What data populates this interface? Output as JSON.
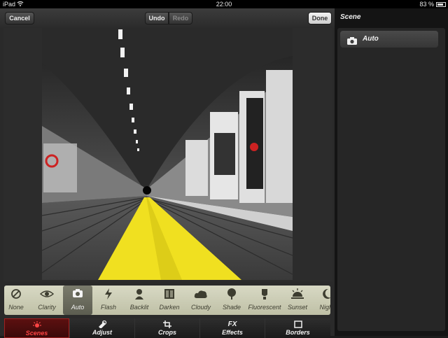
{
  "status_bar": {
    "device": "iPad",
    "time": "22:00",
    "battery": "83 %",
    "battery_level": 0.83
  },
  "toolbar": {
    "cancel_label": "Cancel",
    "undo_label": "Undo",
    "redo_label": "Redo",
    "done_label": "Done"
  },
  "scenes": [
    {
      "label": "None",
      "icon": "none-icon",
      "selected": false
    },
    {
      "label": "Clarity",
      "icon": "eye-icon",
      "selected": false
    },
    {
      "label": "Auto",
      "icon": "camera-icon",
      "selected": true
    },
    {
      "label": "Flash",
      "icon": "flash-icon",
      "selected": false
    },
    {
      "label": "Backlit",
      "icon": "backlit-icon",
      "selected": false
    },
    {
      "label": "Darken",
      "icon": "darken-icon",
      "selected": false
    },
    {
      "label": "Cloudy",
      "icon": "cloud-icon",
      "selected": false
    },
    {
      "label": "Shade",
      "icon": "tree-icon",
      "selected": false
    },
    {
      "label": "Fluorescent",
      "icon": "fluorescent-icon",
      "selected": false
    },
    {
      "label": "Sunset",
      "icon": "sunset-icon",
      "selected": false
    },
    {
      "label": "Night",
      "icon": "moon-icon",
      "selected": false
    }
  ],
  "tabs": [
    {
      "label": "Scenes",
      "icon": "scenes-icon",
      "active": true
    },
    {
      "label": "Adjust",
      "icon": "adjust-icon",
      "active": false
    },
    {
      "label": "Crops",
      "icon": "crop-icon",
      "active": false
    },
    {
      "label": "Effects",
      "icon": "fx-icon",
      "fx_text": "FX",
      "active": false
    },
    {
      "label": "Borders",
      "icon": "borders-icon",
      "active": false
    }
  ],
  "panel": {
    "title": "Scene",
    "selected_item": "Auto",
    "selected_icon": "camera-icon"
  },
  "colors": {
    "accent_red": "#e03030",
    "platform_line": "#f0e020",
    "scene_strip": "#cfd0b8"
  }
}
